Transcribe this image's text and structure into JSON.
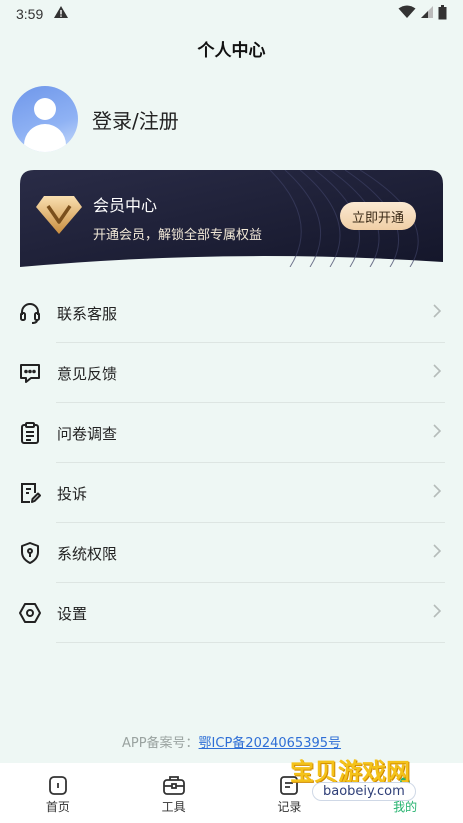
{
  "status_bar": {
    "time": "3:59",
    "icons": [
      "warning-icon",
      "wifi-icon",
      "signal-icon",
      "battery-icon"
    ]
  },
  "header": {
    "title": "个人中心"
  },
  "profile": {
    "login_label": "登录/注册"
  },
  "vip_card": {
    "title": "会员中心",
    "subtitle": "开通会员，解锁全部专属权益",
    "button_label": "立即开通"
  },
  "menu": [
    {
      "label": "联系客服",
      "icon": "headset-icon"
    },
    {
      "label": "意见反馈",
      "icon": "feedback-icon"
    },
    {
      "label": "问卷调查",
      "icon": "clipboard-icon"
    },
    {
      "label": "投诉",
      "icon": "complaint-icon"
    },
    {
      "label": "系统权限",
      "icon": "shield-icon"
    },
    {
      "label": "设置",
      "icon": "settings-icon"
    }
  ],
  "footer": {
    "icp_label": "APP备案号：",
    "icp_number": "鄂ICP备2024065395号"
  },
  "tabbar": [
    {
      "label": "首页",
      "icon": "home-icon",
      "active": false
    },
    {
      "label": "工具",
      "icon": "toolbox-icon",
      "active": false
    },
    {
      "label": "记录",
      "icon": "record-icon",
      "active": false
    },
    {
      "label": "我的",
      "icon": "profile-icon",
      "active": true
    }
  ],
  "watermark": {
    "text": "宝贝游戏网",
    "url": "baobeiy.com"
  },
  "colors": {
    "accent": "#23b26d",
    "background": "#eef7f4",
    "vip_dark": "#1c1e36",
    "vip_button": "#f0cfa6",
    "link": "#2f6fd6"
  }
}
